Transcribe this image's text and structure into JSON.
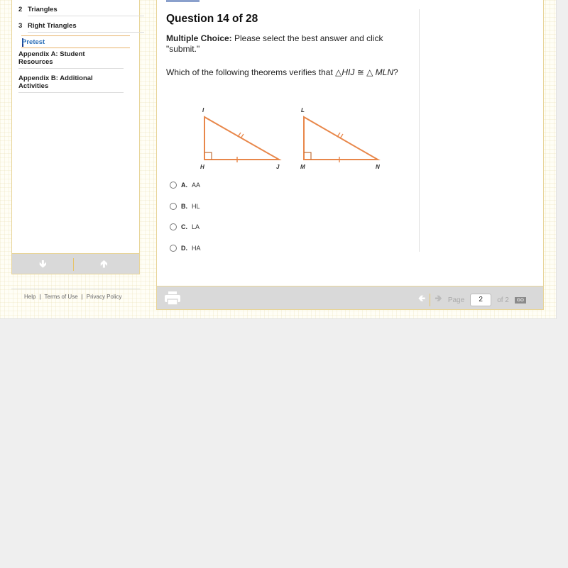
{
  "sidebar": {
    "items": [
      {
        "num": "2",
        "label": "Triangles"
      },
      {
        "num": "3",
        "label": "Right Triangles"
      }
    ],
    "active_item": "Pretest",
    "appendices": [
      {
        "line1": "Appendix A: Student",
        "line2": "Resources"
      },
      {
        "line1": "Appendix B: Additional",
        "line2": "Activities"
      }
    ],
    "nav": {
      "down_icon": "arrow-down-icon",
      "up_icon": "arrow-up-icon"
    }
  },
  "footer": {
    "links": [
      "Help",
      "Terms of Use",
      "Privacy Policy"
    ],
    "separator": "|"
  },
  "question": {
    "title": "Question 14 of 28",
    "type_label": "Multiple Choice:",
    "instruction": " Please select the best answer and click \"submit.\"",
    "prompt_prefix": "Which of the following theorems verifies that ",
    "prompt_triangle1": "HIJ",
    "prompt_congruent": "≅",
    "prompt_triangle2": "MLN",
    "prompt_suffix": "?",
    "figure": {
      "triangle1": {
        "top": "I",
        "right_angle": "H",
        "far": "J"
      },
      "triangle2": {
        "top": "L",
        "right_angle": "M",
        "far": "N"
      },
      "stroke_color": "#e8874a"
    },
    "choices": [
      {
        "letter": "A.",
        "text": "AA"
      },
      {
        "letter": "B.",
        "text": "HL"
      },
      {
        "letter": "C.",
        "text": "LA"
      },
      {
        "letter": "D.",
        "text": "HA"
      }
    ]
  },
  "toolbar": {
    "print_icon": "printer-icon",
    "page_label": "Page",
    "page_value": "2",
    "page_total": "of 2",
    "go_label": "GO"
  }
}
